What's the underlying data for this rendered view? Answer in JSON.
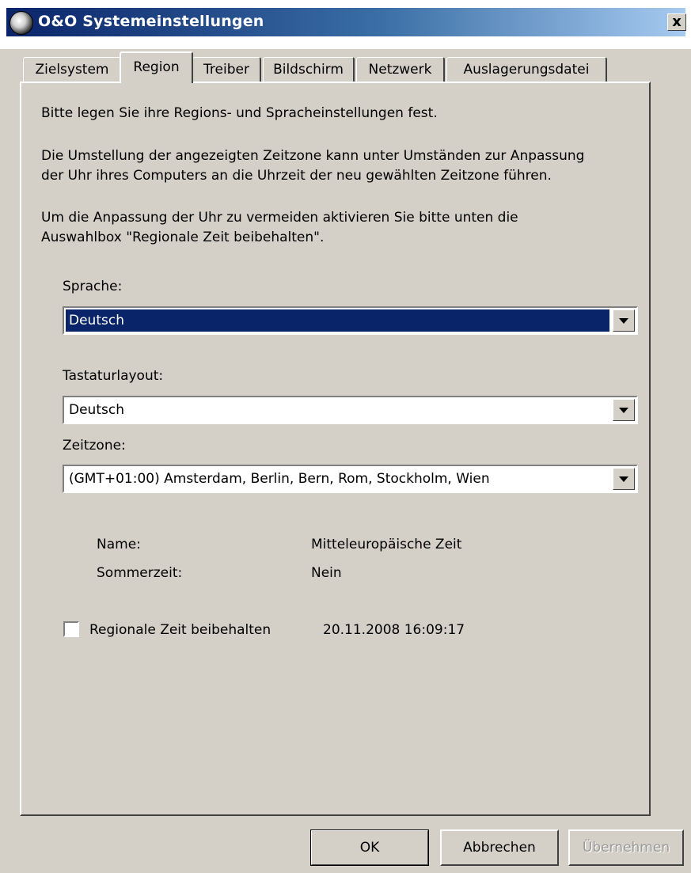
{
  "window": {
    "title": "O&O Systemeinstellungen",
    "close_label": "x"
  },
  "tabs": [
    "Zielsystem",
    "Region",
    "Treiber",
    "Bildschirm",
    "Netzwerk",
    "Auslagerungsdatei"
  ],
  "region": {
    "intro": "Bitte legen Sie ihre Regions- und Spracheinstellungen fest.",
    "info1_line1": "Die Umstellung der angezeigten Zeitzone kann unter Umständen zur Anpassung",
    "info1_line2": "der Uhr ihres Computers an die Uhrzeit der neu gewählten Zeitzone führen.",
    "info2_line1": "Um die Anpassung der Uhr zu vermeiden aktivieren Sie bitte unten die",
    "info2_line2": "Auswahlbox \"Regionale Zeit beibehalten\".",
    "language_label": "Sprache:",
    "language_value": "Deutsch",
    "keyboard_label": "Tastaturlayout:",
    "keyboard_value": "Deutsch",
    "timezone_label": "Zeitzone:",
    "timezone_value": "(GMT+01:00) Amsterdam, Berlin, Bern, Rom, Stockholm, Wien",
    "name_label": "Name:",
    "name_value": "Mitteleuropäische Zeit",
    "dst_label": "Sommerzeit:",
    "dst_value": "Nein",
    "keep_time_label": "Regionale Zeit beibehalten",
    "keep_time_checked": false,
    "datetime": "20.11.2008 16:09:17"
  },
  "buttons": {
    "ok": "OK",
    "cancel": "Abbrechen",
    "apply": "Übernehmen"
  },
  "colors": {
    "face": "#d4d0c8",
    "title_start": "#0a246a",
    "selection": "#0a246a"
  }
}
